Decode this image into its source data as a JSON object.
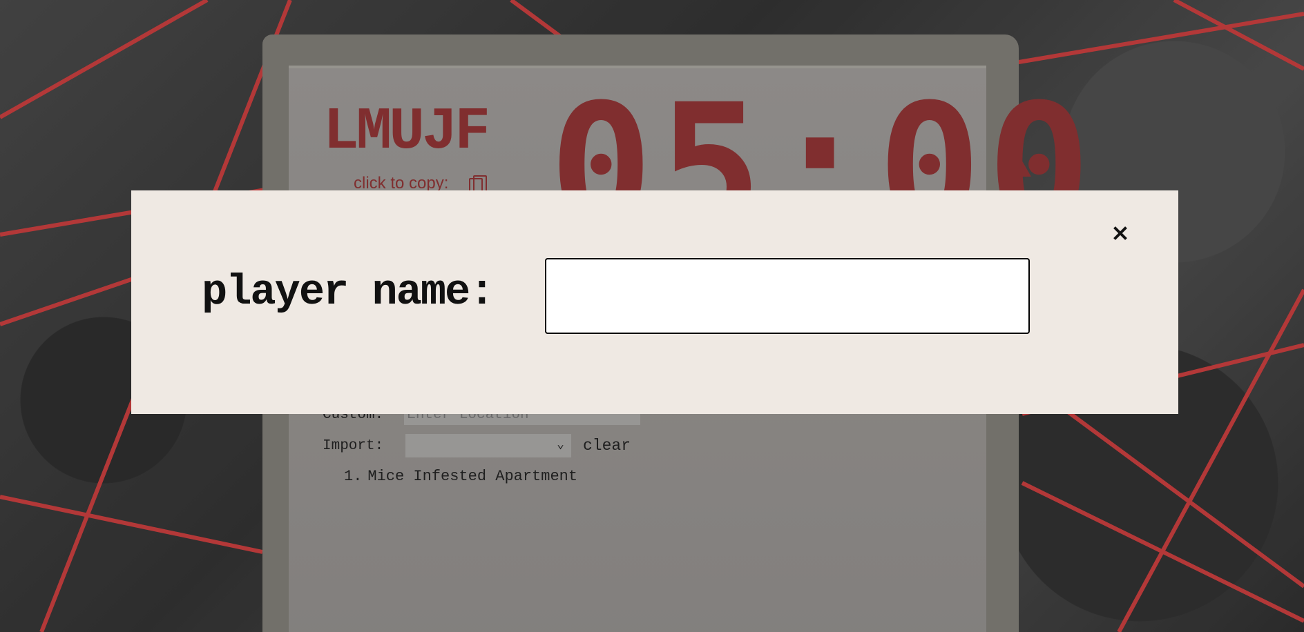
{
  "app": {
    "logo": "LMUJF",
    "copy_label": "click to copy:",
    "timer": "05:00"
  },
  "form": {
    "custom_label": "Custom:",
    "custom_placeholder": "Enter Location",
    "import_label": "Import:",
    "import_selected": "",
    "clear_label": "clear"
  },
  "locations": [
    {
      "number": "1.",
      "name": "Mice Infested Apartment"
    }
  ],
  "modal": {
    "label": "player name:",
    "input_value": "",
    "input_placeholder": ""
  },
  "colors": {
    "accent": "#8c2f30",
    "modal_bg": "#efe9e3",
    "string": "#c73b3b"
  },
  "icons": {
    "copy": "copy-icon",
    "close": "close-icon",
    "timer_up": "triangle-up-icon",
    "select": "chevron-down-icon"
  }
}
